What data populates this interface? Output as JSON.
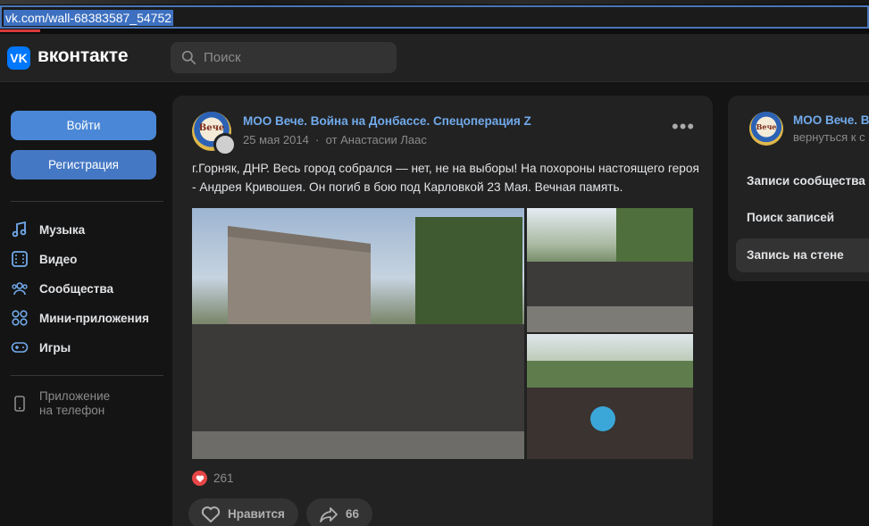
{
  "browser": {
    "url": "vk.com/wall-68383587_54752"
  },
  "header": {
    "logo_mark": "VK",
    "logo_text": "вконтакте",
    "search_placeholder": "Поиск"
  },
  "sidebar": {
    "login_label": "Войти",
    "register_label": "Регистрация",
    "nav": [
      {
        "label": "Музыка",
        "icon": "music-icon"
      },
      {
        "label": "Видео",
        "icon": "video-icon"
      },
      {
        "label": "Сообщества",
        "icon": "communities-icon"
      },
      {
        "label": "Мини-приложения",
        "icon": "mini-apps-icon"
      },
      {
        "label": "Игры",
        "icon": "games-icon"
      }
    ],
    "app_label_line1": "Приложение",
    "app_label_line2": "на телефон"
  },
  "post": {
    "author": "МОО Вече. Война на Донбассе. Спецоперация Z",
    "date": "25 мая 2014",
    "from": "от Анастасии Лаас",
    "text": "г.Горняк, ДНР. Весь город собрался — нет, не на выборы! На похороны настоящего героя - Андрея Кривошея. Он погиб в бою под Карловкой 23 Мая. Вечная память.",
    "likes": "261",
    "like_label": "Нравится",
    "shares": "66",
    "avatar_text": "Вече"
  },
  "right_panel": {
    "title": "МОО Вече. Во",
    "back": "вернуться к с",
    "items": [
      "Записи сообщества",
      "Поиск записей",
      "Запись на стене"
    ],
    "active_index": 2
  },
  "colors": {
    "accent": "#71aaeb",
    "button": "#4a87d6",
    "background": "#141414",
    "card": "#222222",
    "like": "#e64646"
  }
}
